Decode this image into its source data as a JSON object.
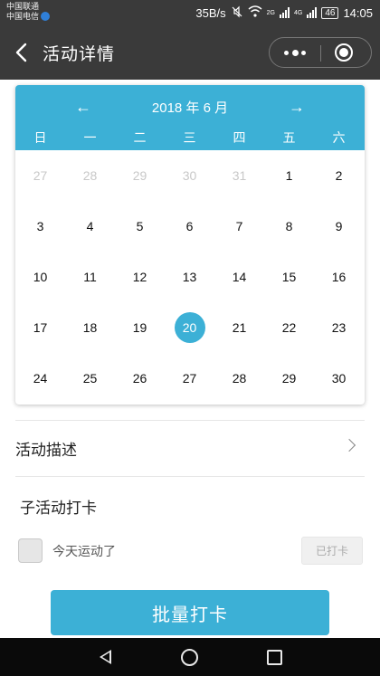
{
  "status_bar": {
    "carrier1": "中国联通",
    "carrier2": "中国电信",
    "speed": "35B/s",
    "signal1": "2G",
    "signal2": "4G",
    "battery": "46",
    "time": "14:05"
  },
  "nav": {
    "title": "活动详情"
  },
  "calendar": {
    "prev_arrow": "←",
    "next_arrow": "→",
    "month_title": "2018 年 6 月",
    "weekdays": [
      "日",
      "一",
      "二",
      "三",
      "四",
      "五",
      "六"
    ],
    "weeks": [
      [
        {
          "d": "27",
          "other": true
        },
        {
          "d": "28",
          "other": true
        },
        {
          "d": "29",
          "other": true
        },
        {
          "d": "30",
          "other": true
        },
        {
          "d": "31",
          "other": true
        },
        {
          "d": "1"
        },
        {
          "d": "2"
        }
      ],
      [
        {
          "d": "3"
        },
        {
          "d": "4"
        },
        {
          "d": "5"
        },
        {
          "d": "6"
        },
        {
          "d": "7"
        },
        {
          "d": "8"
        },
        {
          "d": "9"
        }
      ],
      [
        {
          "d": "10"
        },
        {
          "d": "11"
        },
        {
          "d": "12"
        },
        {
          "d": "13"
        },
        {
          "d": "14"
        },
        {
          "d": "15"
        },
        {
          "d": "16"
        }
      ],
      [
        {
          "d": "17"
        },
        {
          "d": "18"
        },
        {
          "d": "19"
        },
        {
          "d": "20",
          "selected": true
        },
        {
          "d": "21"
        },
        {
          "d": "22"
        },
        {
          "d": "23"
        }
      ],
      [
        {
          "d": "24"
        },
        {
          "d": "25"
        },
        {
          "d": "26"
        },
        {
          "d": "27"
        },
        {
          "d": "28"
        },
        {
          "d": "29"
        },
        {
          "d": "30"
        }
      ]
    ],
    "accent_color": "#3cb0d6"
  },
  "description_row": {
    "label": "活动描述"
  },
  "sub_activity": {
    "title": "子活动打卡",
    "item_label": "今天运动了",
    "status_button": "已打卡"
  },
  "batch_button": "批量打卡"
}
